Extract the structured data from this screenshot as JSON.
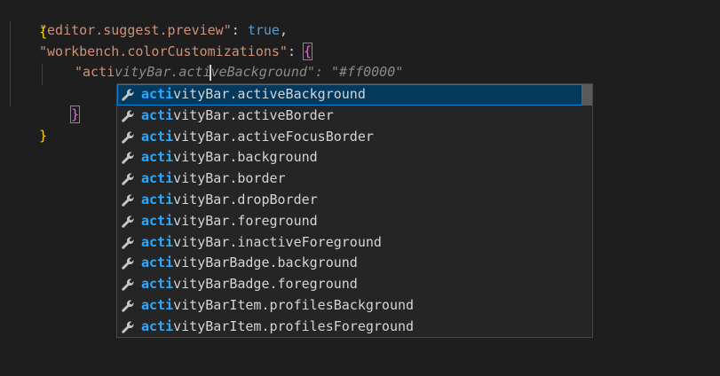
{
  "editor": {
    "open_brace": "{",
    "line2": {
      "key": "\"editor.suggest.preview\"",
      "colon": ": ",
      "value": "true",
      "comma": ","
    },
    "line3": {
      "key": "\"workbench.colorCustomizations\"",
      "colon": ": ",
      "brace": "{"
    },
    "line4": {
      "typed": "\"acti",
      "ghost": "vityBar.activeBackground\": \"#ff0000\""
    },
    "line5": {
      "brace": "}"
    },
    "close_brace": "}"
  },
  "suggestions": {
    "match_prefix": "acti",
    "items": [
      {
        "rest": "vityBar.activeBackground"
      },
      {
        "rest": "vityBar.activeBorder"
      },
      {
        "rest": "vityBar.activeFocusBorder"
      },
      {
        "rest": "vityBar.background"
      },
      {
        "rest": "vityBar.border"
      },
      {
        "rest": "vityBar.dropBorder"
      },
      {
        "rest": "vityBar.foreground"
      },
      {
        "rest": "vityBar.inactiveForeground"
      },
      {
        "rest": "vityBarBadge.background"
      },
      {
        "rest": "vityBarBadge.foreground"
      },
      {
        "rest": "vityBarItem.profilesBackground"
      },
      {
        "rest": "vityBarItem.profilesForeground"
      }
    ],
    "selected_index": 0,
    "icon": "wrench-icon"
  },
  "colors": {
    "background": "#1e1e1e",
    "string": "#ce9178",
    "keyword": "#569cd6",
    "bracket_level1": "#ffd700",
    "bracket_level2": "#da70d6",
    "match_highlight": "#2aaaff",
    "selection": "#04395e"
  }
}
